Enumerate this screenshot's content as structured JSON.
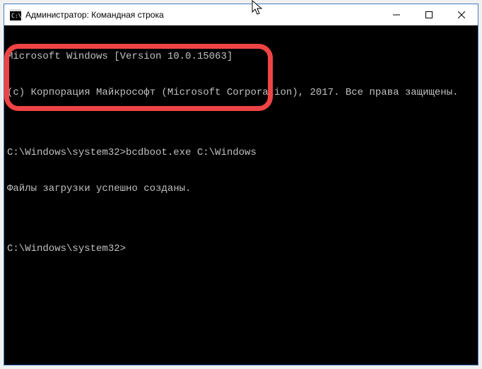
{
  "window": {
    "title": "Администратор: Командная строка"
  },
  "terminal": {
    "lines": [
      "Microsoft Windows [Version 10.0.15063]",
      "(c) Корпорация Майкрософт (Microsoft Corporation), 2017. Все права защищены.",
      "",
      "C:\\Windows\\system32>bcdboot.exe C:\\Windows",
      "Файлы загрузки успешно созданы.",
      "",
      "C:\\Windows\\system32>"
    ]
  },
  "controls": {
    "minimize": "",
    "maximize": "",
    "close": ""
  }
}
